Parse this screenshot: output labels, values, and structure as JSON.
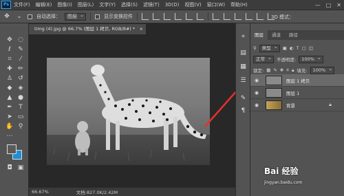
{
  "menubar": {
    "logo": "Ps",
    "items": [
      "文件(F)",
      "编辑(E)",
      "图像(I)",
      "图层(L)",
      "文字(Y)",
      "选择(S)",
      "滤镜(T)",
      "3D(D)",
      "视图(V)",
      "窗口(W)",
      "帮助(H)"
    ],
    "win_controls": [
      "—",
      "□",
      "✕"
    ]
  },
  "options": {
    "auto_select_label": "自动选择：",
    "auto_select_value": "图层",
    "transform_label": "显示变换控件",
    "mode_3d_label": "3D 模式："
  },
  "document": {
    "tab_title": "timg (4).jpg @ 66.7% (图层 1 拷贝, RGB/8#) *",
    "tab_close": "×",
    "zoom": "66.67%",
    "doc_info": "文档:827.0K/2.42M"
  },
  "tools": {
    "foreground_color": "#5a5a5a",
    "background_color": "#1f8fd8"
  },
  "layers_panel": {
    "tabs": [
      "图层",
      "通道",
      "路径"
    ],
    "filter_kind": "类型",
    "blend_mode": "正常",
    "opacity_label": "不透明度:",
    "opacity_value": "100%",
    "lock_label": "锁定:",
    "fill_label": "填充:",
    "fill_value": "100%",
    "layers": [
      {
        "name": "图层 1 拷贝",
        "selected": true
      },
      {
        "name": "图层 1",
        "selected": false
      },
      {
        "name": "背景",
        "selected": false,
        "locked": true
      }
    ]
  },
  "watermark": {
    "brand": "Bai 经验",
    "url": "jingyan.baidu.com"
  }
}
